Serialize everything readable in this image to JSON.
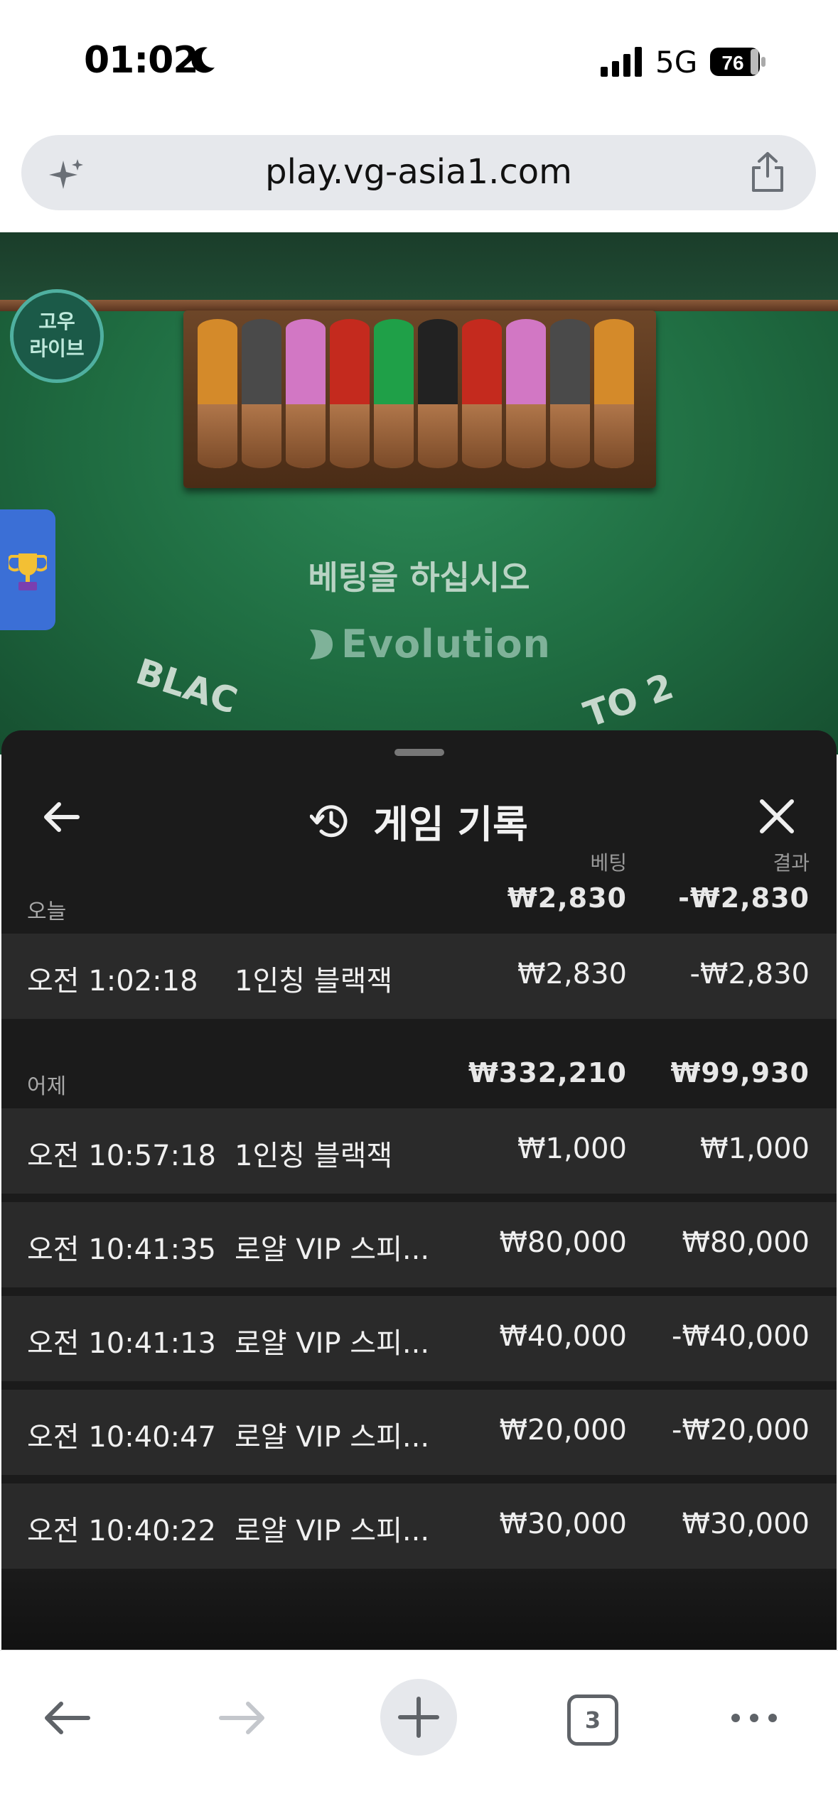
{
  "status_bar": {
    "time": "01:02",
    "network": "5G",
    "battery": "76"
  },
  "browser": {
    "url": "play.vg-asia1.com",
    "tab_count": "3"
  },
  "game": {
    "badge_line1": "고우",
    "badge_line2": "라이브",
    "prompt": "베팅을 하십시오",
    "provider": "Evolution",
    "table_text_left": "BLAC",
    "table_text_right": "TO 2"
  },
  "history": {
    "title": "게임 기록",
    "bet_header": "베팅",
    "result_header": "결과",
    "groups": [
      {
        "label": "오늘",
        "bet_total": "₩2,830",
        "result_total": "-₩2,830",
        "rows": [
          {
            "time": "오전 1:02:18",
            "game": "1인칭 블랙잭",
            "bet": "₩2,830",
            "result": "-₩2,830"
          }
        ]
      },
      {
        "label": "어제",
        "bet_total": "₩332,210",
        "result_total": "₩99,930",
        "rows": [
          {
            "time": "오전 10:57:18",
            "game": "1인칭 블랙잭",
            "bet": "₩1,000",
            "result": "₩1,000"
          },
          {
            "time": "오전 10:41:35",
            "game": "로얄 VIP 스피...",
            "bet": "₩80,000",
            "result": "₩80,000"
          },
          {
            "time": "오전 10:41:13",
            "game": "로얄 VIP 스피...",
            "bet": "₩40,000",
            "result": "-₩40,000"
          },
          {
            "time": "오전 10:40:47",
            "game": "로얄 VIP 스피...",
            "bet": "₩20,000",
            "result": "-₩20,000"
          },
          {
            "time": "오전 10:40:22",
            "game": "로얄 VIP 스피...",
            "bet": "₩30,000",
            "result": "₩30,000"
          }
        ]
      }
    ]
  }
}
